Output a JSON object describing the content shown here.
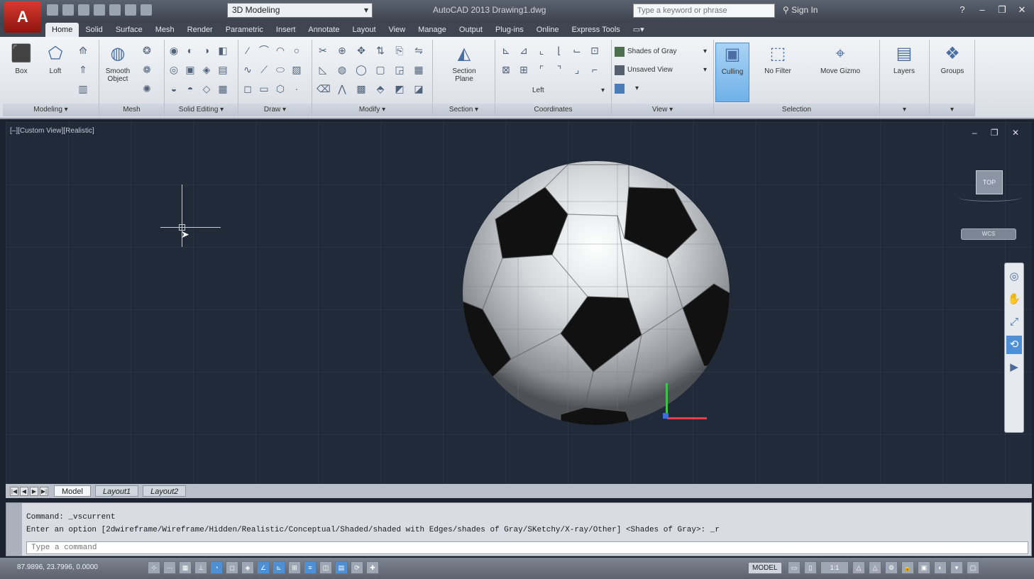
{
  "app": {
    "product_title": "AutoCAD 2013   Drawing1.dwg",
    "app_button_glyph": "A",
    "workspace": "3D Modeling",
    "search_placeholder": "Type a keyword or phrase",
    "sign_in": "Sign In",
    "accent_color": "#4d90d8"
  },
  "ribbon": {
    "tabs": [
      "Home",
      "Solid",
      "Surface",
      "Mesh",
      "Render",
      "Parametric",
      "Insert",
      "Annotate",
      "Layout",
      "View",
      "Manage",
      "Output",
      "Plug-ins",
      "Online",
      "Express Tools"
    ],
    "panels": {
      "modeling": {
        "title": "Modeling ▾",
        "box": "Box",
        "loft": "Loft"
      },
      "mesh": {
        "title": "Mesh",
        "smooth_object": "Smooth Object"
      },
      "solid_editing": {
        "title": "Solid Editing ▾"
      },
      "draw": {
        "title": "Draw ▾"
      },
      "modify": {
        "title": "Modify ▾"
      },
      "section": {
        "title": "Section ▾",
        "section_plane": "Section Plane"
      },
      "coordinates": {
        "title": "Coordinates",
        "ucs_view": "Left"
      },
      "view": {
        "title": "View ▾",
        "visual_style": "Shades of Gray",
        "saved_view": "Unsaved View"
      },
      "selection": {
        "title": "Selection",
        "culling": "Culling",
        "no_filter": "No Filter",
        "move_gizmo": "Move Gizmo"
      },
      "layers": {
        "title": "Layers",
        "label": "Layers"
      },
      "groups": {
        "title": "Groups",
        "label": "Groups"
      }
    }
  },
  "viewport": {
    "label": "[–][Custom View][Realistic]",
    "controls": "– ❐ ✕",
    "viewcube_face": "TOP",
    "wcs_label": "WCS"
  },
  "layout_tabs": [
    "Model",
    "Layout1",
    "Layout2"
  ],
  "command": {
    "history_1": "Command:  _vscurrent",
    "history_2": "Enter an option [2dwireframe/Wireframe/Hidden/Realistic/Conceptual/Shaded/shaded with Edges/shades of Gray/SKetchy/X-ray/Other] <Shades of Gray>: _r",
    "placeholder": "Type a command"
  },
  "statusbar": {
    "coordinates": "87.9896, 23.7996, 0.0000",
    "model": "MODEL",
    "annotation_scale": "1:1"
  }
}
